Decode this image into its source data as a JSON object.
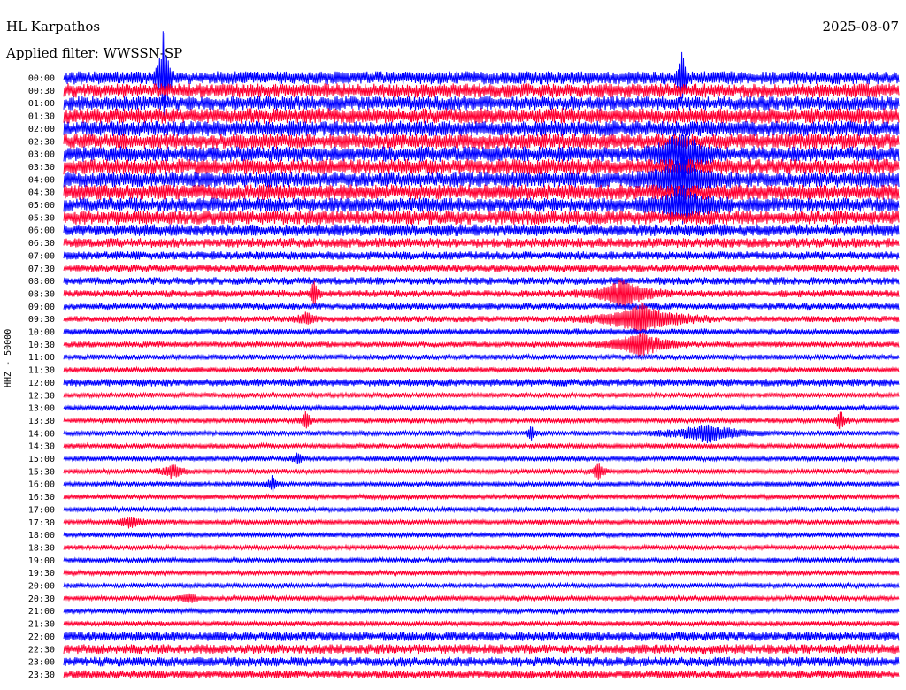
{
  "header": {
    "station": "HL Karpathos",
    "date": "2025-08-07",
    "filter": "Applied filter: WWSSN-SP"
  },
  "axis": {
    "ylabel": "HHZ - 50000"
  },
  "chart_data": {
    "type": "line",
    "title": "HL Karpathos",
    "ylabel": "HHZ - 50000",
    "series_colors": [
      "#0000ff",
      "#ff0033"
    ],
    "row_labels": [
      "00:00",
      "00:30",
      "01:00",
      "01:30",
      "02:00",
      "02:30",
      "03:00",
      "03:30",
      "04:00",
      "04:30",
      "05:00",
      "05:30",
      "06:00",
      "06:30",
      "07:00",
      "07:30",
      "08:00",
      "08:30",
      "09:00",
      "09:30",
      "10:00",
      "10:30",
      "11:00",
      "11:30",
      "12:00",
      "12:30",
      "13:00",
      "13:30",
      "14:00",
      "14:30",
      "15:00",
      "15:30",
      "16:00",
      "16:30",
      "17:00",
      "17:30",
      "18:00",
      "18:30",
      "19:00",
      "19:30",
      "20:00",
      "20:30",
      "21:00",
      "21:30",
      "22:00",
      "22:30",
      "23:00",
      "23:30"
    ],
    "row_noise": [
      5.5,
      6,
      6,
      6.5,
      6.5,
      6.5,
      6.5,
      6.5,
      6.5,
      6.5,
      6,
      6,
      5,
      4,
      3.5,
      3.2,
      3.2,
      3,
      2.8,
      2.6,
      2.6,
      2.4,
      2.2,
      2.2,
      3.2,
      2,
      2,
      2,
      2,
      2,
      2,
      2,
      2,
      2,
      2,
      2,
      2,
      2,
      2,
      2,
      2,
      2,
      2,
      2.2,
      4,
      4,
      4,
      3.5
    ],
    "events": [
      {
        "row": 0,
        "x": 0.12,
        "amp": 60,
        "width": 0.004
      },
      {
        "row": 0,
        "x": 0.74,
        "amp": 40,
        "width": 0.003
      },
      {
        "row": 6,
        "x": 0.74,
        "amp": 28,
        "width": 0.015
      },
      {
        "row": 8,
        "x": 0.74,
        "amp": 22,
        "width": 0.02
      },
      {
        "row": 10,
        "x": 0.74,
        "amp": 18,
        "width": 0.02
      },
      {
        "row": 17,
        "x": 0.3,
        "amp": 16,
        "width": 0.003
      },
      {
        "row": 17,
        "x": 0.67,
        "amp": 16,
        "width": 0.02
      },
      {
        "row": 19,
        "x": 0.69,
        "amp": 18,
        "width": 0.03
      },
      {
        "row": 21,
        "x": 0.69,
        "amp": 16,
        "width": 0.02
      },
      {
        "row": 19,
        "x": 0.29,
        "amp": 8,
        "width": 0.006
      },
      {
        "row": 27,
        "x": 0.29,
        "amp": 12,
        "width": 0.004
      },
      {
        "row": 27,
        "x": 0.93,
        "amp": 14,
        "width": 0.004
      },
      {
        "row": 28,
        "x": 0.56,
        "amp": 10,
        "width": 0.003
      },
      {
        "row": 28,
        "x": 0.77,
        "amp": 10,
        "width": 0.03
      },
      {
        "row": 30,
        "x": 0.28,
        "amp": 10,
        "width": 0.003
      },
      {
        "row": 31,
        "x": 0.13,
        "amp": 8,
        "width": 0.01
      },
      {
        "row": 31,
        "x": 0.64,
        "amp": 12,
        "width": 0.004
      },
      {
        "row": 32,
        "x": 0.25,
        "amp": 12,
        "width": 0.003
      },
      {
        "row": 35,
        "x": 0.08,
        "amp": 6,
        "width": 0.01
      },
      {
        "row": 41,
        "x": 0.15,
        "amp": 6,
        "width": 0.006
      }
    ]
  }
}
